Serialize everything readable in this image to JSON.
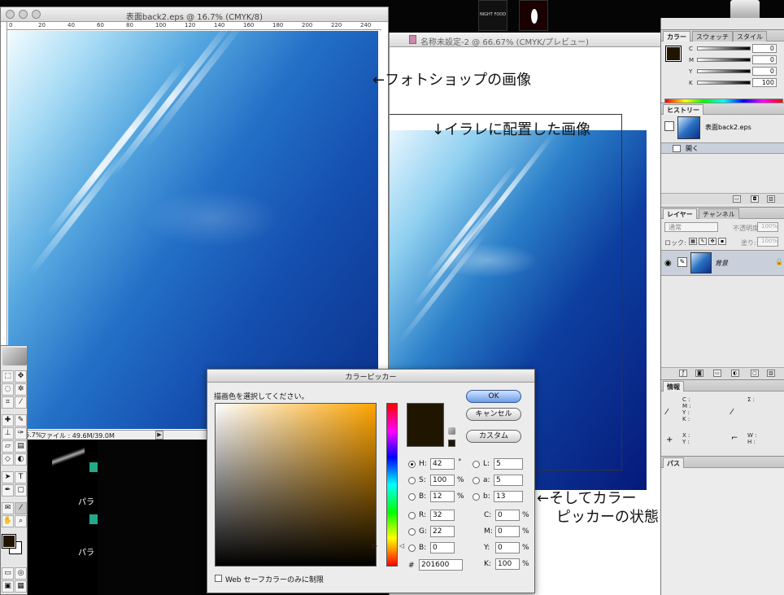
{
  "ps_window": {
    "title": "表面back2.eps @ 16.7% (CMYK/8)",
    "ruler_ticks": [
      "0",
      "20",
      "40",
      "60",
      "80",
      "100",
      "120",
      "140",
      "160",
      "180",
      "200",
      "220",
      "240"
    ],
    "status_zoom": "6.7%",
    "status_file": "ファイル : 49.6M/39.0M"
  },
  "ai_window": {
    "title": "名称未設定-2 @ 66.67% (CMYK/プレビュー)"
  },
  "annotations": {
    "ps_image": "←フォトショップの画像",
    "ai_image": "↓イラレに配置した画像",
    "picker_line1": "←そしてカラー",
    "picker_line2": "ピッカーの状態"
  },
  "thumbnails": {
    "thumb1_text": "NIGHT FOOD"
  },
  "color_palette": {
    "tabs": [
      "カラー",
      "スウォッチ",
      "スタイル"
    ],
    "channels": [
      {
        "label": "C",
        "value": "0"
      },
      {
        "label": "M",
        "value": "0"
      },
      {
        "label": "Y",
        "value": "0"
      },
      {
        "label": "K",
        "value": "100"
      }
    ],
    "percent": "%"
  },
  "history_palette": {
    "tabs": [
      "ヒストリー"
    ],
    "snapshot_name": "表面back2.eps",
    "state_name": "開く"
  },
  "layers_palette": {
    "tabs": [
      "レイヤー",
      "チャンネル"
    ],
    "blend_mode": "通常",
    "opacity_label": "不透明度:",
    "opacity_value": "100%",
    "lock_label": "ロック:",
    "fill_label": "塗り:",
    "fill_value": "100%",
    "layer_name": "背景"
  },
  "info_palette": {
    "tabs": [
      "情報"
    ],
    "cmyk_labels": [
      "C :",
      "M :",
      "Y :",
      "K :"
    ],
    "sigma": "Σ :",
    "xy_labels": [
      "X :",
      "Y :"
    ],
    "wh_labels": [
      "W :",
      "H :"
    ]
  },
  "path_palette": {
    "tabs": [
      "パス"
    ]
  },
  "bg_window": {
    "labels": [
      "パラ",
      "パラ"
    ]
  },
  "tools_palette": {
    "type_tool": "T"
  },
  "color_picker": {
    "title": "カラーピッカー",
    "prompt": "描画色を選択してください。",
    "buttons": {
      "ok": "OK",
      "cancel": "キャンセル",
      "custom": "カスタム"
    },
    "hsb": [
      {
        "label": "H:",
        "value": "42",
        "unit": "°",
        "selected": true
      },
      {
        "label": "S:",
        "value": "100",
        "unit": "%",
        "selected": false
      },
      {
        "label": "B:",
        "value": "12",
        "unit": "%",
        "selected": false
      }
    ],
    "rgb": [
      {
        "label": "R:",
        "value": "32"
      },
      {
        "label": "G:",
        "value": "22"
      },
      {
        "label": "B:",
        "value": "0"
      }
    ],
    "lab": [
      {
        "label": "L:",
        "value": "5"
      },
      {
        "label": "a:",
        "value": "5"
      },
      {
        "label": "b:",
        "value": "13"
      }
    ],
    "cmyk": [
      {
        "label": "C:",
        "value": "0",
        "unit": "%"
      },
      {
        "label": "M:",
        "value": "0",
        "unit": "%"
      },
      {
        "label": "Y:",
        "value": "0",
        "unit": "%"
      },
      {
        "label": "K:",
        "value": "100",
        "unit": "%"
      }
    ],
    "hex_label": "#",
    "hex_value": "201600",
    "web_safe_label": "Web セーフカラーのみに制限",
    "current_color": "#201600"
  }
}
